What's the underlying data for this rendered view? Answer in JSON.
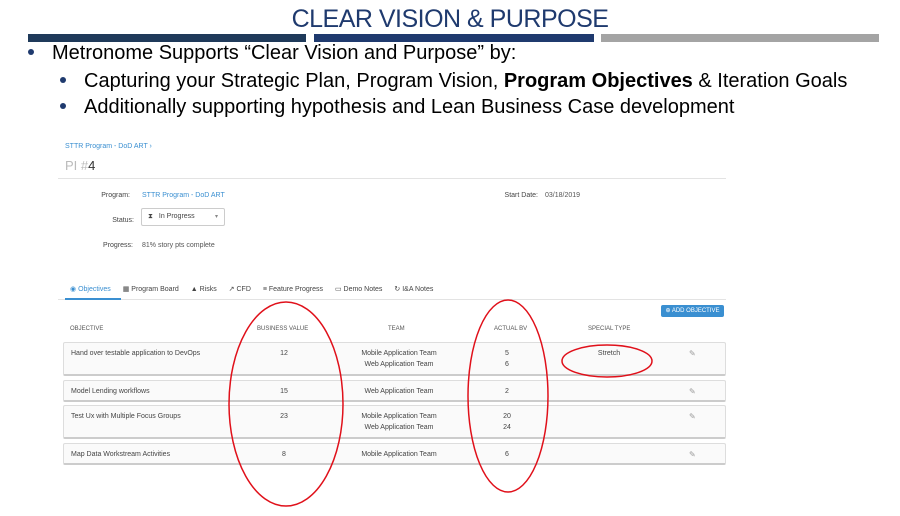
{
  "slide": {
    "title": "CLEAR VISION & PURPOSE",
    "bullet1": "Metronome Supports “Clear Vision and Purpose” by:",
    "bullet2_pre": "Capturing your Strategic Plan, Program Vision, ",
    "bullet2_bold": "Program Objectives",
    "bullet2_post": " & Iteration Goals",
    "bullet3": "Additionally supporting hypothesis and Lean Business Case development"
  },
  "app": {
    "breadcrumb": "STTR Program - DoD ART ›",
    "pi_prefix": "PI #",
    "pi_number": "4",
    "program_label": "Program:",
    "program_value": "STTR Program - DoD ART",
    "start_label": "Start Date:",
    "start_value": "03/18/2019",
    "status_label": "Status:",
    "status_value": "In Progress",
    "progress_label": "Progress:",
    "progress_value": "81% story pts complete",
    "progress_fraction": 0.81,
    "tabs": [
      {
        "icon": "objectives-icon",
        "label": "Objectives"
      },
      {
        "icon": "board-icon",
        "label": "Program Board"
      },
      {
        "icon": "risks-icon",
        "label": "Risks"
      },
      {
        "icon": "cfd-icon",
        "label": "CFD"
      },
      {
        "icon": "feature-progress-icon",
        "label": "Feature Progress"
      },
      {
        "icon": "demo-notes-icon",
        "label": "Demo Notes"
      },
      {
        "icon": "ia-notes-icon",
        "label": "I&A Notes"
      }
    ],
    "add_button": "ADD OBJECTIVE",
    "columns": [
      "OBJECTIVE",
      "BUSINESS VALUE",
      "TEAM",
      "ACTUAL BV",
      "SPECIAL TYPE"
    ],
    "rows": [
      {
        "objective": "Hand over testable application to DevOps",
        "bv": "12",
        "team1": "Mobile Application Team",
        "team2": "Web Application Team",
        "abv1": "5",
        "abv2": "6",
        "special": "Stretch"
      },
      {
        "objective": "Model Lending workflows",
        "bv": "15",
        "team1": "Web Application Team",
        "team2": "",
        "abv1": "2",
        "abv2": "",
        "special": ""
      },
      {
        "objective": "Test Ux with Multiple Focus Groups",
        "bv": "23",
        "team1": "Mobile Application Team",
        "team2": "Web Application Team",
        "abv1": "20",
        "abv2": "24",
        "special": ""
      },
      {
        "objective": "Map Data Workstream Activities",
        "bv": "8",
        "team1": "Mobile Application Team",
        "team2": "",
        "abv1": "6",
        "abv2": "",
        "special": ""
      }
    ]
  },
  "colors": {
    "title": "#1f3a6e",
    "accent": "#3a8fd1",
    "annotation": "#e0101a"
  }
}
